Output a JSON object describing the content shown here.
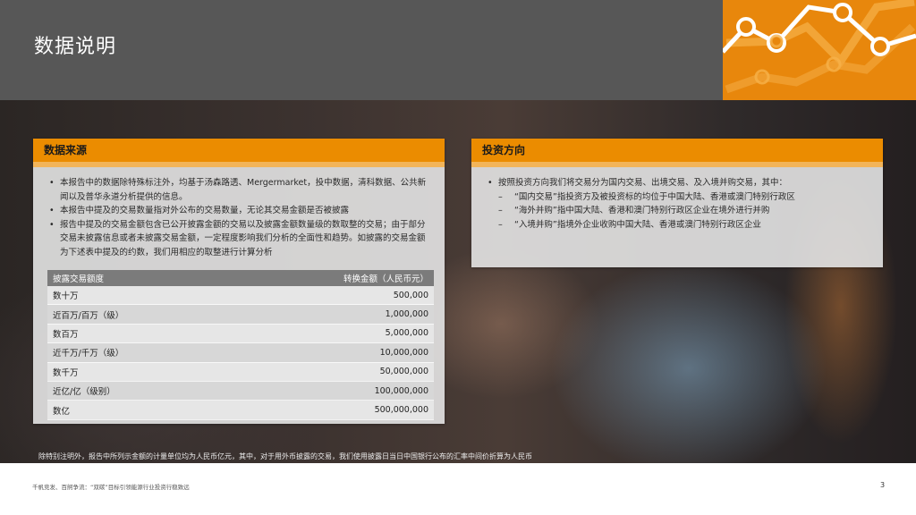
{
  "header": {
    "title": "数据说明"
  },
  "data_source": {
    "heading": "数据来源",
    "bullets": [
      "本报告中的数据除特殊标注外，均基于汤森路透、Mergermarket，投中数据，清科数据、公共新闻以及普华永道分析提供的信息。",
      "本报告中提及的交易数量指对外公布的交易数量，无论其交易金额是否被披露",
      "报告中提及的交易金额包含已公开披露金额的交易以及披露金额数量级的数取整的交易；由于部分交易未披露信息或者未披露交易金额，一定程度影响我们分析的全面性和趋势。如披露的交易金额为下述表中提及的约数，我们用相应的取整进行计算分析"
    ],
    "table": {
      "headers": [
        "披露交易额度",
        "转换金额（人民币元）"
      ],
      "rows": [
        [
          "数十万",
          "500,000"
        ],
        [
          "近百万/百万（级）",
          "1,000,000"
        ],
        [
          "数百万",
          "5,000,000"
        ],
        [
          "近千万/千万（级）",
          "10,000,000"
        ],
        [
          "数千万",
          "50,000,000"
        ],
        [
          "近亿/亿（级别）",
          "100,000,000"
        ],
        [
          "数亿",
          "500,000,000"
        ]
      ]
    }
  },
  "investment_direction": {
    "heading": "投资方向",
    "intro": "按照投资方向我们将交易分为国内交易、出境交易、及入境并购交易，其中：",
    "subs": [
      "“国内交易”指投资方及被投资标的均位于中国大陆、香港或澳门特别行政区",
      "“海外并购”指中国大陆、香港和澳门特别行政区企业在境外进行并购",
      "“入境并购”指境外企业收购中国大陆、香港或澳门特别行政区企业"
    ]
  },
  "footnote": "除特别注明外，报告中所列示金额的计量单位均为人民币亿元，其中，对于用外币披露的交易，我们使用披露日当日中国银行公布的汇率中间价折算为人民币",
  "footer": {
    "text": "千帆竞发、百舸争流：“双碳”目标引领能源行业投资行稳致远",
    "page": "3"
  },
  "colors": {
    "accent": "#eb8c00",
    "logo_bg": "#e8870c",
    "top_band": "#575757",
    "table_header": "#7b7b7b"
  }
}
